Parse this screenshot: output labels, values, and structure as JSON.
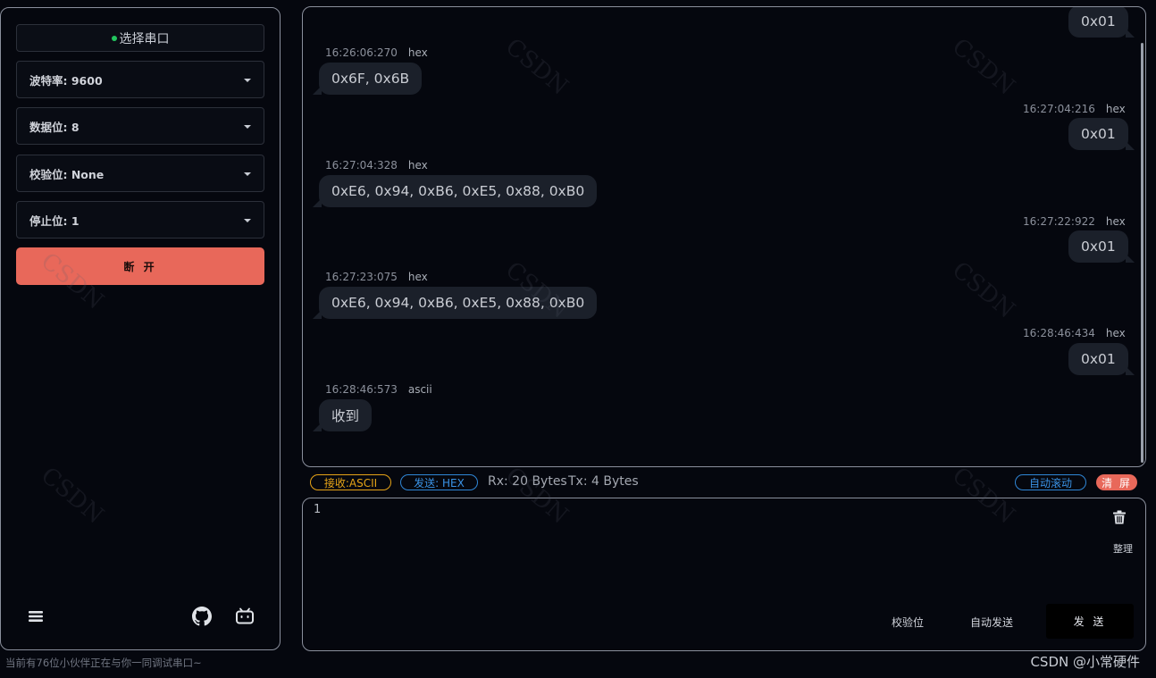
{
  "sidebar": {
    "port_select_label": "选择串口",
    "baud_rate": "波特率: 9600",
    "data_bits": "数据位: 8",
    "parity": "校验位: None",
    "stop_bits": "停止位: 1",
    "disconnect_label": "断 开",
    "icons": [
      "menu-icon",
      "github-icon",
      "bilibili-icon"
    ]
  },
  "messages": [
    {
      "side": "right",
      "text": "0x01"
    },
    {
      "side": "left",
      "time": "16:26:06:270",
      "format": "hex",
      "text": "0x6F, 0x6B"
    },
    {
      "side": "right",
      "time": "16:27:04:216",
      "format": "hex",
      "text": "0x01"
    },
    {
      "side": "left",
      "time": "16:27:04:328",
      "format": "hex",
      "text": "0xE6, 0x94, 0xB6, 0xE5, 0x88, 0xB0"
    },
    {
      "side": "right",
      "time": "16:27:22:922",
      "format": "hex",
      "text": "0x01"
    },
    {
      "side": "left",
      "time": "16:27:23:075",
      "format": "hex",
      "text": "0xE6, 0x94, 0xB6, 0xE5, 0x88, 0xB0"
    },
    {
      "side": "right",
      "time": "16:28:46:434",
      "format": "hex",
      "text": "0x01"
    },
    {
      "side": "left",
      "time": "16:28:46:573",
      "format": "ascii",
      "text": "收到"
    }
  ],
  "status": {
    "rx_mode": "接收:ASCII",
    "tx_mode": "发送: HEX",
    "rx_bytes": "Rx: 20 Bytes",
    "tx_bytes": "Tx: 4 Bytes",
    "auto_scroll": "自动滚动",
    "clear": "清 屏"
  },
  "input": {
    "value": "1",
    "tidy_label": "整理",
    "checksum_label": "校验位",
    "auto_send_label": "自动发送",
    "send_label": "发 送"
  },
  "footer": {
    "online_text": "当前有76位小伙伴正在与你一同调试串口~",
    "credit": "CSDN @小常硬件"
  },
  "colors": {
    "accent_red": "#e8685a",
    "rx_tag": "#e6a317",
    "tx_tag": "#2f86d6",
    "connected_dot": "#22c55e",
    "bubble": "#1b202a"
  }
}
